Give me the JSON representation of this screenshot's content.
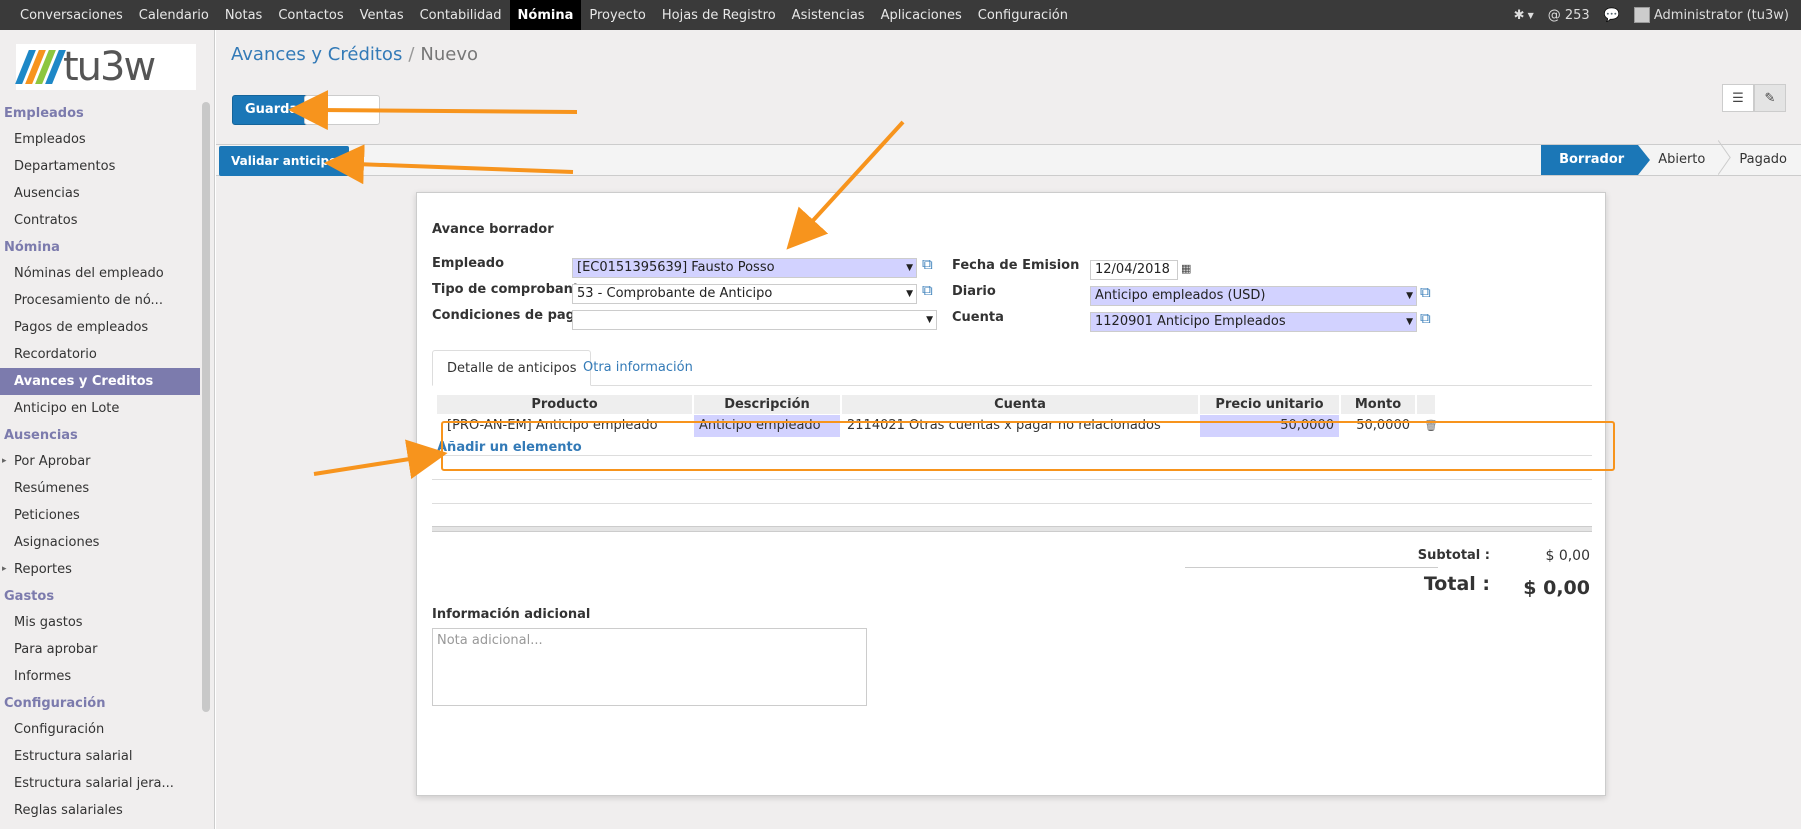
{
  "topbar": {
    "menu": [
      "Conversaciones",
      "Calendario",
      "Notas",
      "Contactos",
      "Ventas",
      "Contabilidad",
      "Nómina",
      "Proyecto",
      "Hojas de Registro",
      "Asistencias",
      "Aplicaciones",
      "Configuración"
    ],
    "active_index": 6,
    "messages_count": "@ 253",
    "user": "Administrator (tu3w)"
  },
  "logo": {
    "text": "tu3w"
  },
  "sidebar": {
    "sections": [
      {
        "title": "Empleados",
        "items": [
          "Empleados",
          "Departamentos",
          "Ausencias",
          "Contratos"
        ]
      },
      {
        "title": "Nómina",
        "items": [
          "Nóminas del empleado",
          "Procesamiento de nó...",
          "Pagos de empleados",
          "Recordatorio",
          "Avances y Creditos",
          "Anticipo en Lote"
        ]
      },
      {
        "title": "Ausencias",
        "items": [
          "Por Aprobar",
          "Resúmenes",
          "Peticiones",
          "Asignaciones",
          "Reportes"
        ]
      },
      {
        "title": "Gastos",
        "items": [
          "Mis gastos",
          "Para aprobar",
          "Informes"
        ]
      },
      {
        "title": "Configuración",
        "items": [
          "Configuración",
          "Estructura salarial",
          "Estructura salarial jera...",
          "Reglas salariales"
        ]
      }
    ],
    "active_item": "Avances y Creditos"
  },
  "breadcrumb": {
    "parent": "Avances y Créditos",
    "separator": "/",
    "current": "Nuevo"
  },
  "buttons": {
    "save": "Guardar",
    "validate": "Validar anticipo"
  },
  "stages": [
    "Borrador",
    "Abierto",
    "Pagado"
  ],
  "form": {
    "title": "Avance borrador",
    "empleado_label": "Empleado",
    "empleado_value": "[EC0151395639] Fausto Posso",
    "tipo_label": "Tipo de comprobante",
    "tipo_value": "53 - Comprobante de Anticipo",
    "condiciones_label": "Condiciones de pago",
    "condiciones_value": "",
    "fecha_label": "Fecha de Emision",
    "fecha_value": "12/04/2018",
    "diario_label": "Diario",
    "diario_value": "Anticipo empleados (USD)",
    "cuenta_label": "Cuenta",
    "cuenta_value": "1120901 Anticipo Empleados"
  },
  "tabs": [
    "Detalle de anticipos",
    "Otra información"
  ],
  "lines": {
    "headers": [
      "Producto",
      "Descripción",
      "Cuenta",
      "Precio unitario",
      "Monto"
    ],
    "rows": [
      [
        "[PRO-AN-EM] Anticipo empleado",
        "Anticipo empleado",
        "2114021 Otras cuentas x pagar no relacionados",
        "50,0000",
        "50,0000"
      ]
    ],
    "add_line": "Añadir un elemento"
  },
  "totals": {
    "subtotal_label": "Subtotal :",
    "subtotal_value": "$ 0,00",
    "total_label": "Total :",
    "total_value": "$ 0,00"
  },
  "notes": {
    "label": "Información adicional",
    "placeholder": "Nota adicional..."
  },
  "colors": {
    "brand": "#1b77b7",
    "sidebar_accent": "#7c7bad",
    "annotation": "#f7941d",
    "required_field": "#d2d2ff"
  }
}
